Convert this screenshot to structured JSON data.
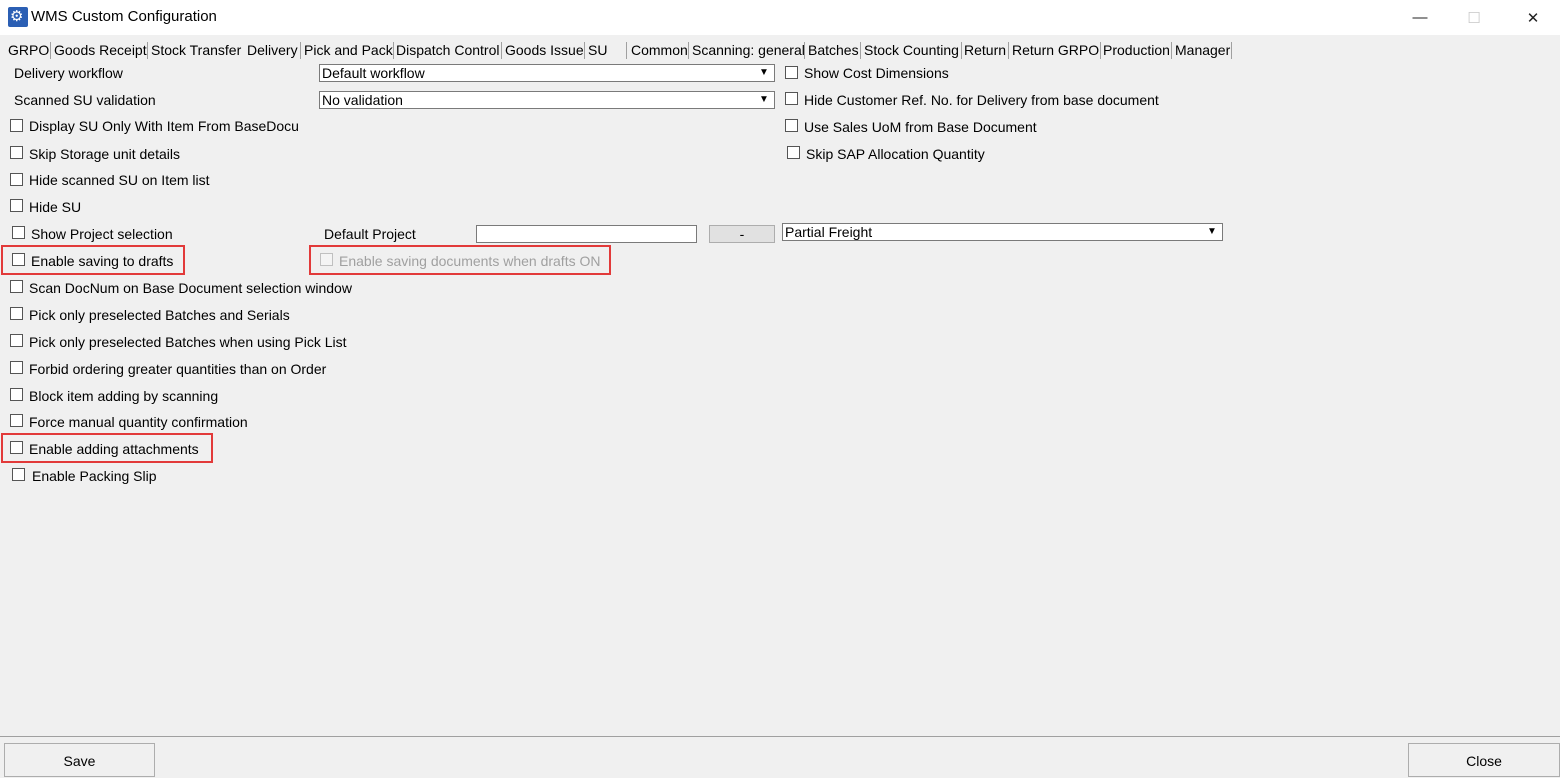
{
  "window": {
    "title": "WMS Custom Configuration",
    "icon": "gear-icon",
    "minimize_glyph": "—",
    "maximize_glyph": "☐",
    "close_glyph": "✕"
  },
  "tabs": [
    {
      "label": "GRPO"
    },
    {
      "label": "Goods Receipt"
    },
    {
      "label": "Stock Transfer"
    },
    {
      "label": "Delivery",
      "active": true
    },
    {
      "label": "Pick and Pack"
    },
    {
      "label": "Dispatch Control"
    },
    {
      "label": "Goods Issue"
    },
    {
      "label": "SU"
    },
    {
      "label": "Common"
    },
    {
      "label": "Scanning: general"
    },
    {
      "label": "Batches"
    },
    {
      "label": "Stock Counting"
    },
    {
      "label": "Return"
    },
    {
      "label": "Return GRPO"
    },
    {
      "label": "Production"
    },
    {
      "label": "Manager"
    }
  ],
  "left_fields": {
    "delivery_workflow_label": "Delivery workflow",
    "delivery_workflow_value": "Default workflow",
    "scanned_su_validation_label": "Scanned SU validation",
    "scanned_su_validation_value": "No validation",
    "default_project_label": "Default Project",
    "default_project_value": "",
    "project_button_label": "-",
    "freight_value": "Partial Freight"
  },
  "left_checkboxes": [
    {
      "label": "Display SU Only With Item From BaseDocu",
      "checked": false
    },
    {
      "label": "Skip Storage unit details",
      "checked": false
    },
    {
      "label": "Hide scanned SU on Item list",
      "checked": false
    },
    {
      "label": "Hide SU",
      "checked": false
    },
    {
      "label": "Show Project selection",
      "checked": false
    },
    {
      "label": "Enable saving to drafts",
      "checked": false
    },
    {
      "label": "Scan DocNum on Base Document selection window",
      "checked": false
    },
    {
      "label": "Pick only preselected Batches and Serials",
      "checked": false
    },
    {
      "label": "Pick only preselected Batches when using Pick List",
      "checked": false
    },
    {
      "label": "Forbid ordering greater quantities than on Order",
      "checked": false
    },
    {
      "label": "Block item adding by scanning",
      "checked": false
    },
    {
      "label": "Force manual quantity confirmation",
      "checked": false
    },
    {
      "label": "Enable adding attachments",
      "checked": false
    },
    {
      "label": "Enable Packing Slip",
      "checked": false
    }
  ],
  "drafts_dependent": {
    "label": "Enable saving documents when drafts ON",
    "checked": false,
    "enabled": false
  },
  "right_checkboxes": [
    {
      "label": "Show Cost Dimensions",
      "checked": false
    },
    {
      "label": "Hide Customer Ref. No. for Delivery from base document",
      "checked": false
    },
    {
      "label": "Use Sales UoM from Base Document",
      "checked": false
    },
    {
      "label": "Skip SAP Allocation Quantity",
      "checked": false
    }
  ],
  "footer": {
    "save_label": "Save",
    "close_label": "Close"
  },
  "highlight_color": "#e23a3a"
}
